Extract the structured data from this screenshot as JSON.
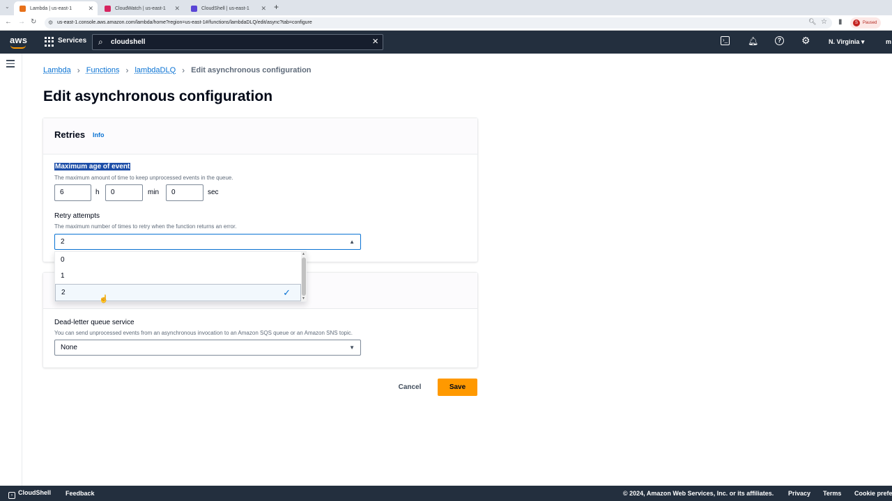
{
  "browser": {
    "tabs": [
      {
        "title": "Lambda | us-east-1",
        "color": "#e7711b"
      },
      {
        "title": "CloudWatch | us-east-1",
        "color": "#d6245f"
      },
      {
        "title": "CloudShell | us-east-1",
        "color": "#5a45d6"
      }
    ],
    "url": "us-east-1.console.aws.amazon.com/lambda/home?region=us-east-1#/functions/lambdaDLQ/edit/async?tab=configure",
    "profile_label": "Paused",
    "profile_initial": "S"
  },
  "awsnav": {
    "logo": "aws",
    "services_label": "Services",
    "search_value": "cloudshell",
    "region_label": "N. Virginia",
    "account_label": "m"
  },
  "breadcrumb": {
    "items": [
      "Lambda",
      "Functions",
      "lambdaDLQ"
    ],
    "current": "Edit asynchronous configuration"
  },
  "page_title": "Edit asynchronous configuration",
  "retries": {
    "title": "Retries",
    "info": "Info",
    "max_age_label": "Maximum age of event",
    "max_age_desc": "The maximum amount of time to keep unprocessed events in the queue.",
    "hours": "6",
    "hours_unit": "h",
    "minutes": "0",
    "minutes_unit": "min",
    "seconds": "0",
    "seconds_unit": "sec",
    "retry_label": "Retry attempts",
    "retry_desc": "The maximum number of times to retry when the function returns an error.",
    "retry_value": "2",
    "retry_options": [
      "0",
      "1",
      "2"
    ]
  },
  "dlq": {
    "label": "Dead-letter queue service",
    "desc": "You can send unprocessed events from an asynchronous invocation to an Amazon SQS queue or an Amazon SNS topic.",
    "value": "None"
  },
  "actions": {
    "cancel": "Cancel",
    "save": "Save"
  },
  "footer": {
    "cloudshell": "CloudShell",
    "feedback": "Feedback",
    "copyright": "© 2024, Amazon Web Services, Inc. or its affiliates.",
    "privacy": "Privacy",
    "terms": "Terms",
    "cookie": "Cookie prefe"
  },
  "colors": {
    "nav_bg": "#232f3e",
    "accent": "#ff9900",
    "link": "#0972d3"
  }
}
